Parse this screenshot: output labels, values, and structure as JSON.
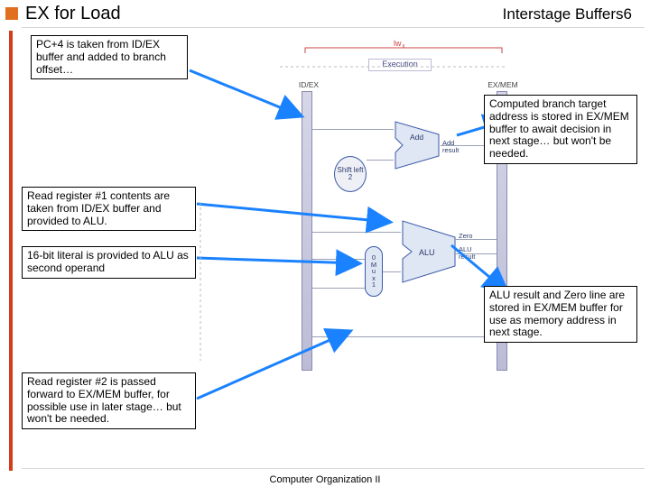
{
  "header": {
    "title": "EX for Load",
    "right_label": "Interstage Buffers",
    "page_number": "6"
  },
  "notes": {
    "n1": "PC+4 is taken from ID/EX buffer and added to branch offset…",
    "n2": "Computed branch target address is stored in EX/MEM buffer to await decision in next stage… but won't be needed.",
    "n3": "Read register #1 contents are taken from ID/EX buffer and provided to ALU.",
    "n4": "16-bit literal is provided to ALU as second operand",
    "n5": "ALU result and Zero line are stored in EX/MEM buffer for use as memory address in next stage.",
    "n6": "Read register #2 is passed forward to EX/MEM buffer, for possible use in later stage… but won't be needed."
  },
  "diagram": {
    "lw": "lw",
    "execution": "Execution",
    "idex": "ID/EX",
    "exmem": "EX/MEM",
    "shift": "Shift left 2",
    "add": "Add",
    "add_result": "Add result",
    "alu": "ALU",
    "alu_result": "ALU result",
    "zero": "Zero",
    "mux0": "0",
    "muxm": "M",
    "muxu": "u",
    "muxx": "x",
    "mux1": "1"
  },
  "footer": "Computer Organization II"
}
